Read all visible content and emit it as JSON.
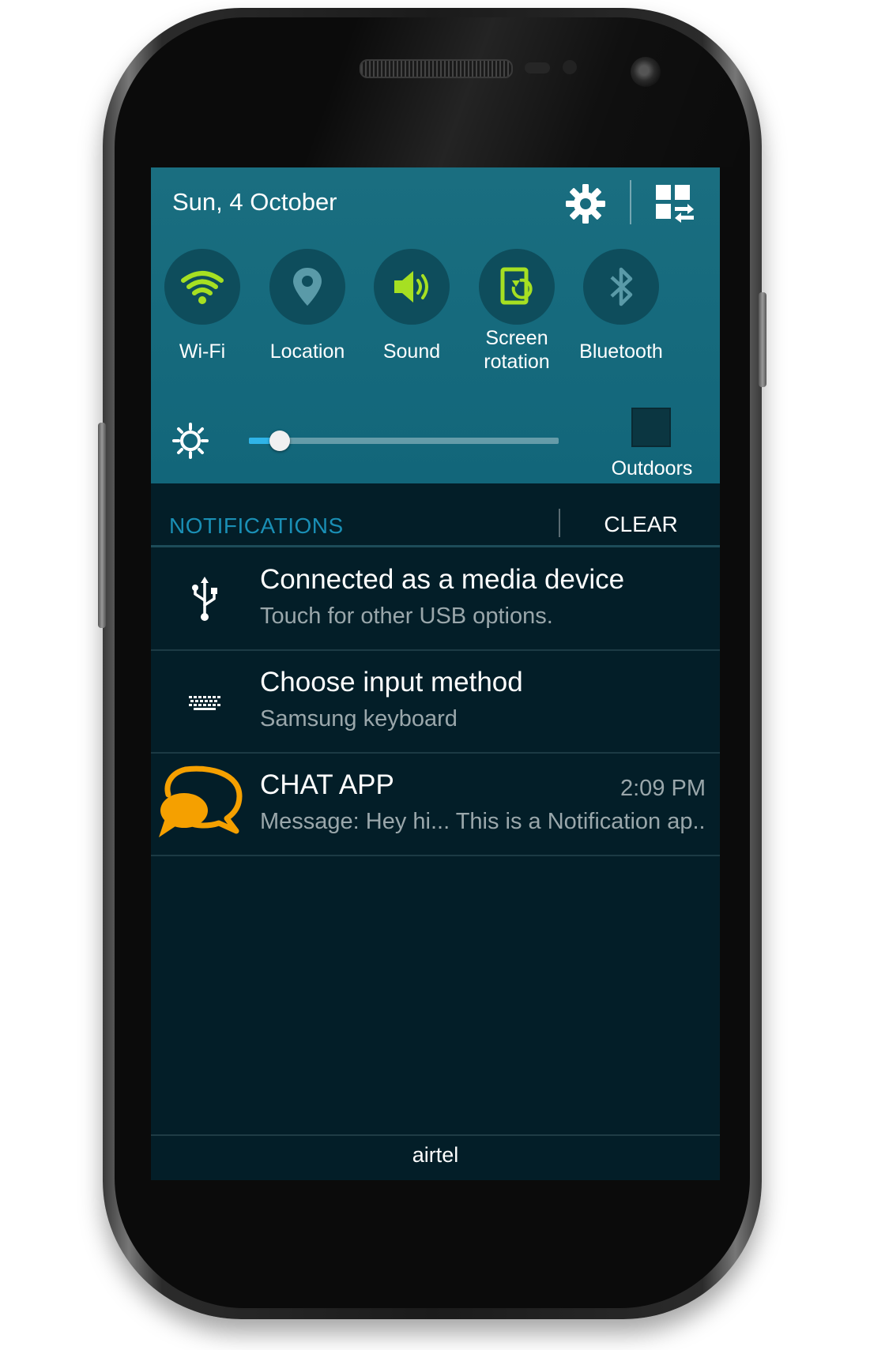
{
  "status_panel": {
    "date": "Sun, 4 October",
    "settings_icon": "gear-icon",
    "edit_icon": "grid-edit-icon"
  },
  "quick_toggles": [
    {
      "label_line1": "Wi-Fi",
      "label_line2": "",
      "icon": "wifi-icon",
      "active": true
    },
    {
      "label_line1": "Location",
      "label_line2": "",
      "icon": "location-pin-icon",
      "active": false
    },
    {
      "label_line1": "Sound",
      "label_line2": "",
      "icon": "speaker-icon",
      "active": true
    },
    {
      "label_line1": "Screen",
      "label_line2": "rotation",
      "icon": "screen-rotation-icon",
      "active": true
    },
    {
      "label_line1": "Bluetooth",
      "label_line2": "",
      "icon": "bluetooth-icon",
      "active": false
    }
  ],
  "brightness": {
    "level": 0.1,
    "outdoors_label": "Outdoors",
    "outdoors_checked": false
  },
  "notifications": {
    "title": "NOTIFICATIONS",
    "clear_label": "CLEAR",
    "items": [
      {
        "icon": "usb-icon",
        "title": "Connected as a media device",
        "subtitle": "Touch for other USB options.",
        "time": ""
      },
      {
        "icon": "keyboard-icon",
        "title": "Choose input method",
        "subtitle": "Samsung keyboard",
        "time": ""
      },
      {
        "icon": "chat-bubbles-icon",
        "title": "CHAT APP",
        "subtitle": "Message: Hey hi... This is a Notification ap..",
        "time": "2:09 PM"
      }
    ]
  },
  "carrier": "airtel",
  "colors": {
    "active_toggle": "#a6e022",
    "inactive_toggle": "#5a9aa8",
    "chat_icon": "#f5a000",
    "accent": "#1a8fb5"
  }
}
